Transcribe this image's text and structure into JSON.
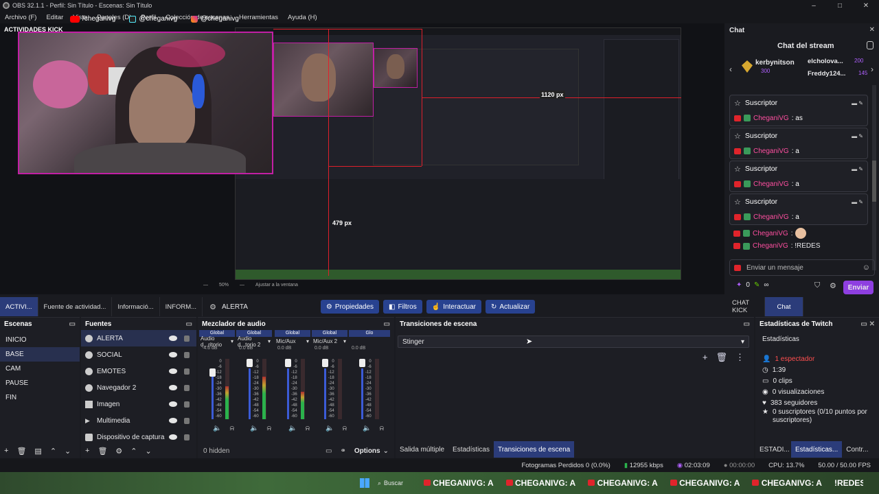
{
  "window": {
    "title": "OBS 32.1.1 - Perfil: Sin Título - Escenas: Sin Título",
    "min": "–",
    "max": "□",
    "close": "✕"
  },
  "menu": [
    "Archivo (F)",
    "Editar",
    "Vista",
    "Paneles (D)",
    "Perfil",
    "Colección de escenas",
    "Herramientas",
    "Ayuda (H)"
  ],
  "overlay": {
    "dock_label": "ACTIVIDADES KICK",
    "yt": "/cheganivg",
    "tt": "@cheganivg",
    "ig": "@cheganivg",
    "px_w": "1120 px",
    "px_h": "479 px"
  },
  "preview_footer": {
    "zoom": "50%",
    "fit": "Ajustar a la ventana"
  },
  "dock_tabs": [
    "ACTIVI...",
    "Fuente de actividad...",
    "Informació...",
    "INFORM..."
  ],
  "source_toolbar": {
    "name": "ALERTA",
    "buttons": [
      "Propiedades",
      "Filtros",
      "Interactuar",
      "Actualizar"
    ]
  },
  "chat": {
    "title": "Chat",
    "subtitle": "Chat del stream",
    "top_user": "kerbynitson",
    "top_points": "300",
    "users": [
      {
        "name": "elcholova...",
        "points": "200"
      },
      {
        "name": "Freddy124...",
        "points": "145"
      }
    ],
    "messages": [
      {
        "type": "Suscriptor",
        "user": "CheganiVG",
        "text": ": as"
      },
      {
        "type": "Suscriptor",
        "user": "CheganiVG",
        "text": ": a"
      },
      {
        "type": "Suscriptor",
        "user": "CheganiVG",
        "text": ": a"
      },
      {
        "type": "Suscriptor",
        "user": "CheganiVG",
        "text": ": a"
      }
    ],
    "plain": [
      {
        "user": "CheganiVG",
        "text": ":"
      },
      {
        "user": "CheganiVG",
        "text": ": !REDES"
      }
    ],
    "input_placeholder": "Enviar un mensaje",
    "points": "0",
    "infinite": "∞",
    "send": "Enviar",
    "tabs": [
      "CHAT KICK",
      "Chat"
    ]
  },
  "scenes": {
    "title": "Escenas",
    "items": [
      "INICIO",
      "BASE",
      "CAM",
      "PAUSE",
      "FIN"
    ],
    "selected": 1
  },
  "sources": {
    "title": "Fuentes",
    "items": [
      "ALERTA",
      "SOCIAL",
      "EMOTES",
      "Navegador 2",
      "Imagen",
      "Multimedia",
      "Dispositivo de captura"
    ]
  },
  "mixer": {
    "title": "Mezclador de audio",
    "channels": [
      {
        "group": "Global",
        "name": "Audio d...ritorio",
        "db": "-4.6 dB",
        "level": 0.55
      },
      {
        "group": "Global",
        "name": "Audio d...torio 2",
        "db": "0.0 dB",
        "level": 0.7
      },
      {
        "group": "Global",
        "name": "Mic/Aux",
        "db": "0.0 dB",
        "level": 0.45
      },
      {
        "group": "Global",
        "name": "Mic/Aux 2",
        "db": "0.0 dB",
        "level": 0.0
      },
      {
        "group": "Glo",
        "name": "",
        "db": "0.0 dB",
        "level": 0.0
      }
    ],
    "ticks": [
      "0",
      "-6",
      "-12",
      "-18",
      "-24",
      "-30",
      "-36",
      "-42",
      "-48",
      "-54",
      "-60"
    ],
    "hidden": "0 hidden",
    "options": "Options"
  },
  "transitions": {
    "title": "Transiciones de escena",
    "selected": "Stinger",
    "tabs": [
      "Salida múltiple",
      "Estadísticas",
      "Transiciones de escena"
    ]
  },
  "twitch": {
    "title": "Estadísticas de Twitch",
    "tab": "Estadísticas",
    "viewers": "1 espectador",
    "time": "1:39",
    "clips": "0 clips",
    "views": "0 visualizaciones",
    "followers": "383 seguidores",
    "subs": "0 suscriptores (0/10 puntos por suscriptores)",
    "bottom_tabs": [
      "ESTADI...",
      "Estadísticas...",
      "Contr..."
    ]
  },
  "status": {
    "dropped": "Fotogramas Perdidos 0 (0.0%)",
    "kbps": "12955 kbps",
    "time1": "02:03:09",
    "time2": "00:00:00",
    "cpu": "CPU: 13.7%",
    "fps": "50.00 / 50.00 FPS"
  },
  "taskbar": {
    "search": "Buscar",
    "ticker": "CHEGANIVG: A",
    "ticker_end": "!REDES"
  },
  "colors": {
    "accent": "#2b3c7a",
    "brand": "#8e3fe0",
    "red": "#e01f2b",
    "border": "#c21fa5"
  }
}
